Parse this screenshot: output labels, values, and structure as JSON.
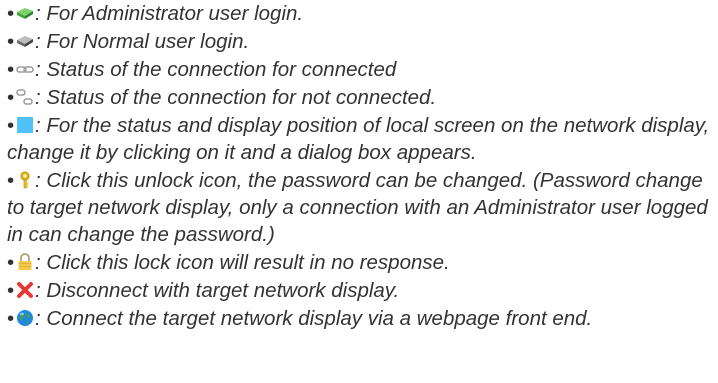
{
  "items": [
    {
      "icon": "admin-login-icon",
      "bullet": "•",
      "text": ": For Administrator user login."
    },
    {
      "icon": "normal-login-icon",
      "bullet": "•",
      "text": ": For Normal user login."
    },
    {
      "icon": "connected-icon",
      "bullet": "•",
      "text": ": Status of the connection for connected"
    },
    {
      "icon": "not-connected-icon",
      "bullet": "•",
      "text": ": Status of the connection for not connected."
    },
    {
      "icon": "local-screen-icon",
      "bullet": "•",
      "text": ": For the status and display position of local screen on the network display, change it by clicking on it and a dialog box appears."
    },
    {
      "icon": "unlock-icon",
      "bullet": "•",
      "text": ": Click this unlock icon, the password can be changed. (Password change to target network display, only a connection with an Administrator user logged in can change the password.)"
    },
    {
      "icon": "lock-icon",
      "bullet": "•",
      "text": ": Click this lock icon will result in no response."
    },
    {
      "icon": "disconnect-icon",
      "bullet": "•",
      "text": ": Disconnect with target network display."
    },
    {
      "icon": "web-icon",
      "bullet": "•",
      "text": ": Connect the target network display via a webpage front end."
    }
  ],
  "colors": {
    "text": "#333333",
    "admin_green": "#3fa535",
    "normal_gray": "#6b6b6b",
    "screen_blue": "#4fc3f7",
    "key_yellow": "#e7c11b",
    "lock_yellow": "#f2c94c",
    "x_red": "#e53935",
    "globe_blue": "#1e88e5"
  }
}
